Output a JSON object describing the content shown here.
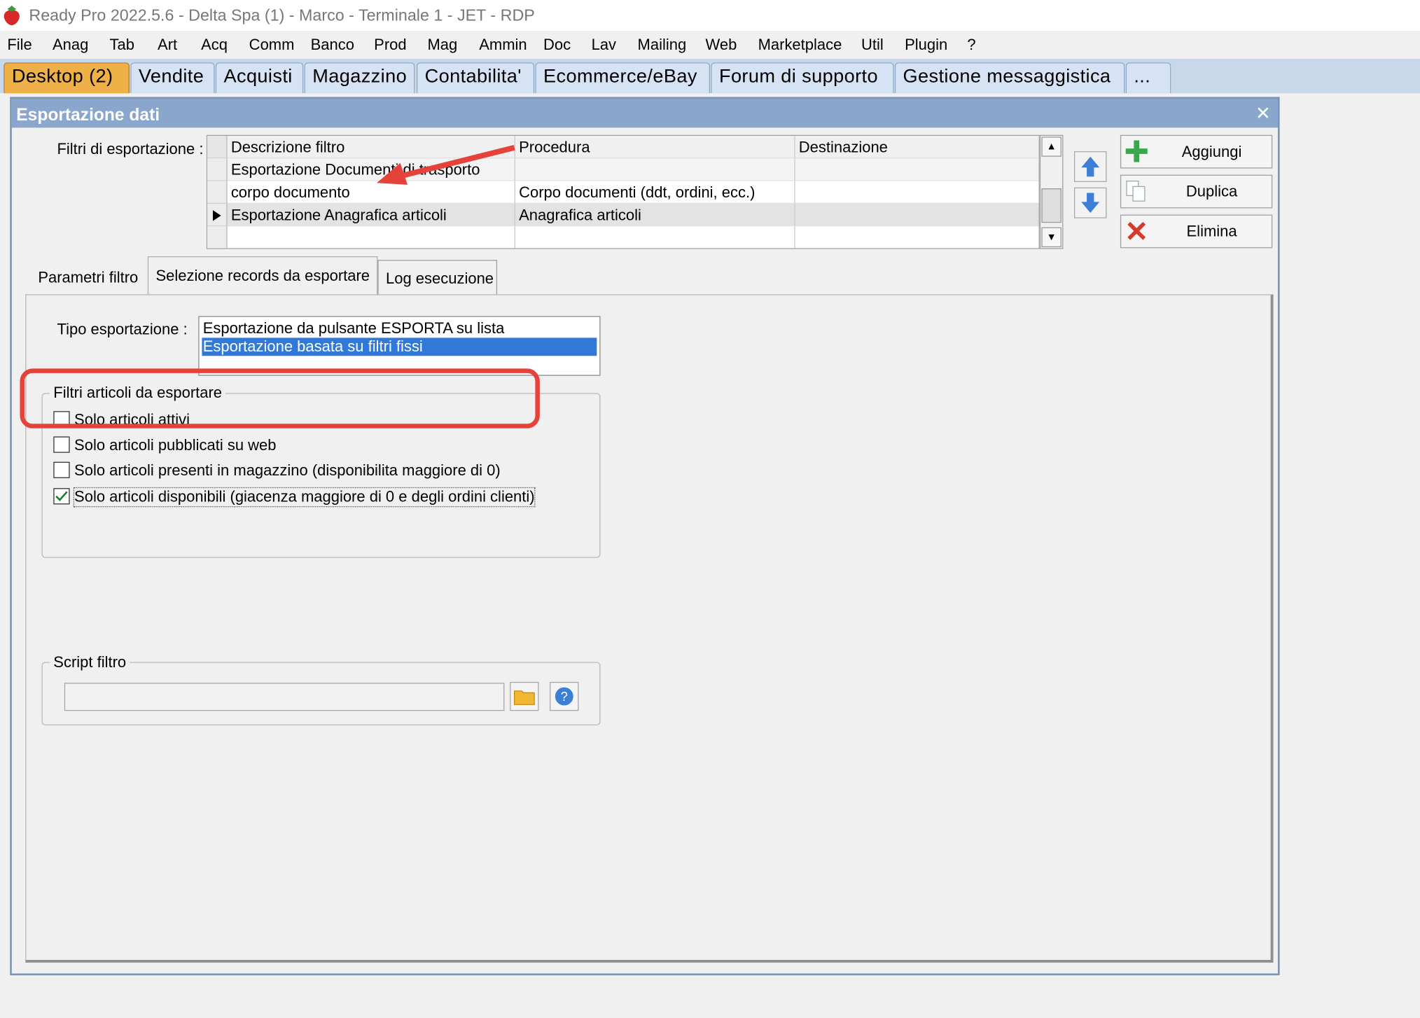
{
  "titlebar": {
    "title": "Ready Pro 2022.5.6 - Delta Spa (1) - Marco - Terminale 1 - JET - RDP"
  },
  "menu": [
    "File",
    "Anag",
    "Tab",
    "Art",
    "Acq",
    "Comm",
    "Banco",
    "Prod",
    "Mag",
    "Ammin",
    "Doc",
    "Lav",
    "Mailing",
    "Web",
    "Marketplace",
    "Util",
    "Plugin",
    "?"
  ],
  "main_tabs": [
    "Desktop (2)",
    "Vendite",
    "Acquisti",
    "Magazzino",
    "Contabilita'",
    "Ecommerce/eBay",
    "Forum di supporto",
    "Gestione messaggistica",
    "..."
  ],
  "window": {
    "title": "Esportazione dati"
  },
  "filters": {
    "label": "Filtri di esportazione :",
    "columns": [
      "Descrizione filtro",
      "Procedura",
      "Destinazione"
    ],
    "rows": [
      [
        "Esportazione Documenti di trasporto",
        "",
        ""
      ],
      [
        "corpo documento",
        "Corpo documenti (ddt, ordini, ecc.)",
        ""
      ],
      [
        "Esportazione Anagrafica articoli",
        "Anagrafica articoli",
        ""
      ]
    ]
  },
  "side_buttons": {
    "add": "Aggiungi",
    "duplicate": "Duplica",
    "delete": "Elimina"
  },
  "tabs": [
    "Parametri filtro",
    "Selezione records da esportare",
    "Log esecuzione"
  ],
  "tipo": {
    "label": "Tipo esportazione :",
    "options": [
      "Esportazione da pulsante ESPORTA su lista",
      "Esportazione basata su filtri fissi"
    ],
    "selected": 1
  },
  "filtri_articoli": {
    "title": "Filtri articoli da esportare",
    "items": [
      {
        "label": "Solo articoli attivi",
        "checked": false
      },
      {
        "label": "Solo articoli pubblicati su web",
        "checked": false
      },
      {
        "label": "Solo articoli presenti in magazzino (disponibilita maggiore di 0)",
        "checked": false
      },
      {
        "label": "Solo articoli disponibili (giacenza maggiore di 0 e degli ordini clienti)",
        "checked": true
      }
    ]
  },
  "script": {
    "title": "Script filtro",
    "value": ""
  },
  "colors": {
    "accent_tab": "#f0b048",
    "selection": "#3179d9",
    "annotation": "#e5423a",
    "window_header": "#8aa6cc"
  }
}
